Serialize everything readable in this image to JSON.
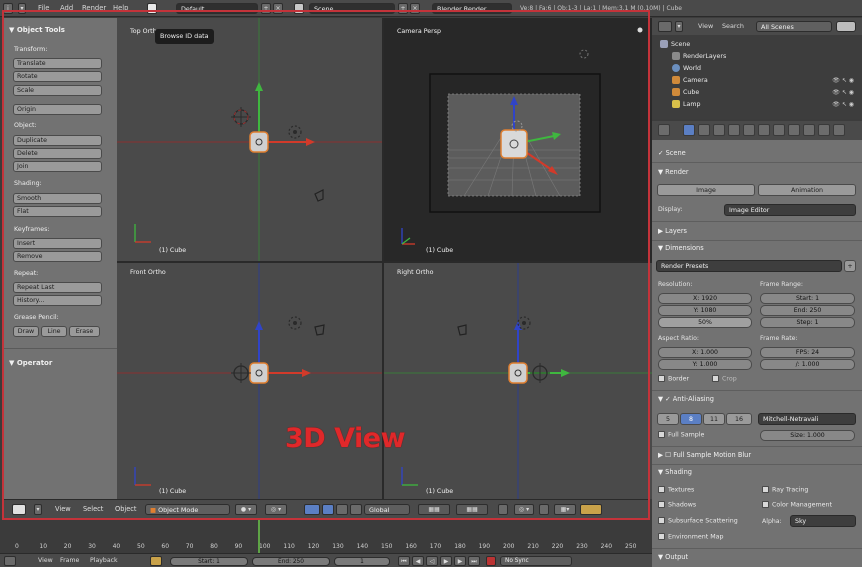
{
  "topbar": {
    "menus": [
      "File",
      "Add",
      "Render",
      "Help"
    ],
    "layout": "Default",
    "scene": "Scene",
    "engine": "Blender Render",
    "stats": "Ve:8 | Fa:6 | Ob:1-3 | La:1 | Mem:3.1 M (0.10M) | Cube"
  },
  "tooltip": "Browse ID data",
  "tool_shelf": {
    "title": "Object Tools",
    "transform_label": "Transform:",
    "translate": "Translate",
    "rotate": "Rotate",
    "scale": "Scale",
    "origin": "Origin",
    "object_label": "Object:",
    "duplicate": "Duplicate",
    "delete": "Delete",
    "join": "Join",
    "shading_label": "Shading:",
    "smooth": "Smooth",
    "flat": "Flat",
    "keyframes_label": "Keyframes:",
    "insert": "Insert",
    "remove": "Remove",
    "repeat_label": "Repeat:",
    "repeat_last": "Repeat Last",
    "history": "History...",
    "grease_label": "Grease Pencil:",
    "draw": "Draw",
    "line": "Line",
    "erase": "Erase",
    "operator": "Operator"
  },
  "viewports": {
    "top": "Top Orth",
    "camera": "Camera Persp",
    "front": "Front Ortho",
    "right": "Right Ortho",
    "object_label": "(1) Cube"
  },
  "view_title": "3D View",
  "view_header": {
    "view": "View",
    "select": "Select",
    "object": "Object",
    "mode": "Object Mode",
    "orientation": "Global"
  },
  "outliner": {
    "view": "View",
    "search": "Search",
    "filter": "All Scenes",
    "items": [
      "Scene",
      "RenderLayers",
      "World",
      "Camera",
      "Cube",
      "Lamp"
    ]
  },
  "properties": {
    "scene": "Scene",
    "render": "Render",
    "image": "Image",
    "animation": "Animation",
    "display_label": "Display:",
    "display_value": "Image Editor",
    "layers": "Layers",
    "dimensions": "Dimensions",
    "render_presets": "Render Presets",
    "resolution_label": "Resolution:",
    "res_x": "X: 1920",
    "res_y": "Y: 1080",
    "res_pct": "50%",
    "frame_range_label": "Frame Range:",
    "start": "Start: 1",
    "end": "End: 250",
    "step": "Step: 1",
    "aspect_label": "Aspect Ratio:",
    "asp_x": "X: 1.000",
    "asp_y": "Y: 1.000",
    "frame_rate_label": "Frame Rate:",
    "fps": "FPS: 24",
    "fps_base": "/: 1.000",
    "border": "Border",
    "crop": "Crop",
    "anti_aliasing": "Anti-Aliasing",
    "aa_samples": [
      "5",
      "8",
      "11",
      "16"
    ],
    "filter": "Mitchell-Netravali",
    "full_sample": "Full Sample",
    "size": "Size: 1.000",
    "motion_blur": "Full Sample Motion Blur",
    "shading": "Shading",
    "textures": "Textures",
    "ray_tracing": "Ray Tracing",
    "shadows": "Shadows",
    "color_management": "Color Management",
    "sss": "Subsurface Scattering",
    "alpha_label": "Alpha:",
    "alpha_value": "Sky",
    "env_map": "Environment Map",
    "output": "Output"
  },
  "timeline": {
    "ticks": [
      "0",
      "10",
      "20",
      "30",
      "40",
      "50",
      "60",
      "70",
      "80",
      "90",
      "100",
      "110",
      "120",
      "130",
      "140",
      "150",
      "160",
      "170",
      "180",
      "190",
      "200",
      "210",
      "220",
      "230",
      "240",
      "250"
    ],
    "view": "View",
    "frame": "Frame",
    "playback": "Playback",
    "start": "Start: 1",
    "end": "End: 250",
    "current": "1",
    "sync": "No Sync"
  },
  "colors": {
    "x_axis": "#d23a2a",
    "y_axis": "#3fb73f",
    "z_axis": "#3044c8",
    "highlight_frame": "#c4333a",
    "title_red": "#e0282a"
  }
}
